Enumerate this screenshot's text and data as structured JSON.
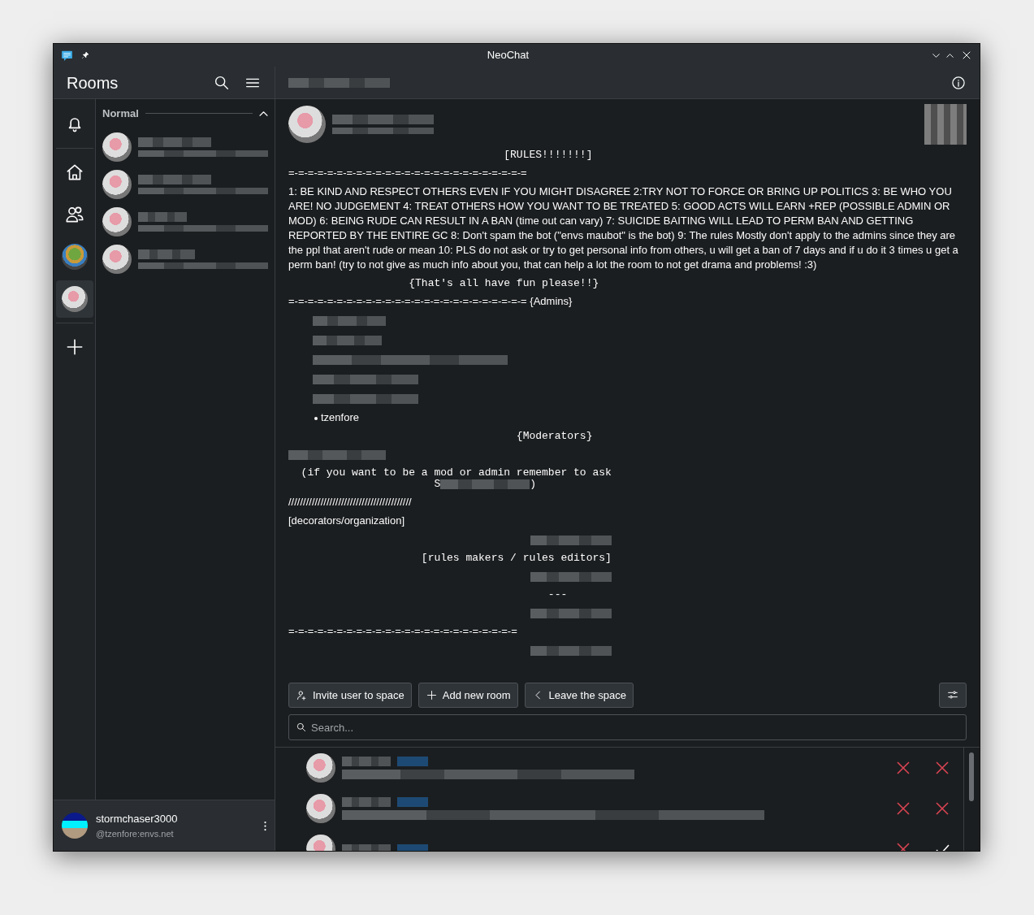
{
  "window": {
    "title": "NeoChat"
  },
  "sidebar": {
    "title": "Rooms",
    "spaces": [
      {
        "kind": "bell",
        "selected": false
      },
      {
        "kind": "home",
        "selected": false
      },
      {
        "kind": "people",
        "selected": false
      },
      {
        "kind": "space-avatar",
        "selected": false
      },
      {
        "kind": "room-avatar",
        "selected": true
      },
      {
        "kind": "add",
        "selected": false
      }
    ],
    "section": {
      "label": "Normal",
      "expanded": true
    },
    "rooms": [
      {
        "kind": "redacted"
      },
      {
        "kind": "redacted"
      },
      {
        "kind": "redacted"
      },
      {
        "kind": "redacted"
      }
    ],
    "user": {
      "name": "stormchaser3000",
      "id": "@tzenfore:envs.net"
    }
  },
  "message": {
    "lines": [
      {
        "kind": "mono",
        "text": "                                  [RULES!!!!!!!]"
      },
      {
        "kind": "text",
        "text": "=-=-=-=-=-=-=-=-=-=-=-=-=-=-=-=-=-=-=-=-=-=-=-=-="
      },
      {
        "kind": "text",
        "text": "1: BE KIND AND RESPECT OTHERS EVEN IF YOU MIGHT DISAGREE 2:TRY NOT TO FORCE OR BRING UP POLITICS 3: BE WHO YOU ARE! NO JUDGEMENT 4: TREAT OTHERS HOW YOU WANT TO BE TREATED 5: GOOD ACTS WILL EARN +REP (POSSIBLE ADMIN OR MOD) 6: BEING RUDE CAN RESULT IN A BAN (time out can vary) 7: SUICIDE BAITING WILL LEAD TO PERM BAN AND GETTING REPORTED BY THE ENTIRE GC 8: Don't spam the bot (\"envs maubot\" is the bot) 9: The rules Mostly don't apply to the admins since they are the ppl that aren't rude or mean 10: PLS do not ask or try to get personal info from others, u will get a ban of 7 days and if u do it 3 times u get a perm ban! (try to not give as much info about you, that can help a lot the room to not get drama and problems! :3)"
      },
      {
        "kind": "mono",
        "text": "                   {That's all have fun please!!}"
      },
      {
        "kind": "text",
        "text": "=-=-=-=-=-=-=-=-=-=-=-=-=-=-=-=-=-=-=-=-=-=-=-=-= {Admins}"
      },
      {
        "kind": "bullet-redacted"
      },
      {
        "kind": "bullet-redacted"
      },
      {
        "kind": "bullet-redacted"
      },
      {
        "kind": "bullet-redacted"
      },
      {
        "kind": "bullet-redacted"
      },
      {
        "kind": "bullet",
        "text": "tzenfore"
      },
      {
        "kind": "mono",
        "text": "                                    {Moderators}"
      },
      {
        "kind": "redacted-left"
      },
      {
        "kind": "mono",
        "text": "  (if you want to be a mod or admin remember to ask"
      },
      {
        "kind": "mono-redacted",
        "text": "                       S",
        "after": ")"
      },
      {
        "kind": "text",
        "text": "//////////////////////////////////////////"
      },
      {
        "kind": "text",
        "text": "[decorators/organization]"
      },
      {
        "kind": "redacted-center"
      },
      {
        "kind": "mono",
        "text": "                     [rules makers / rules editors]"
      },
      {
        "kind": "redacted-center"
      },
      {
        "kind": "mono",
        "text": "                                         ---"
      },
      {
        "kind": "redacted-center"
      },
      {
        "kind": "text",
        "text": "=-=-=-=-=-=-=-=-=-=-=-=-=-=-=-=-=-=-=-=-=-=-=-="
      },
      {
        "kind": "redacted-center"
      }
    ]
  },
  "actions": [
    {
      "kind": "invite",
      "label": "Invite user to space"
    },
    {
      "kind": "add",
      "label": "Add new room"
    },
    {
      "kind": "leave",
      "label": "Leave the space"
    }
  ],
  "search": {
    "placeholder": "Search..."
  },
  "requests": [
    {
      "actions": [
        {
          "kind": "reject"
        },
        {
          "kind": "reject"
        }
      ]
    },
    {
      "actions": [
        {
          "kind": "reject"
        },
        {
          "kind": "reject"
        }
      ]
    },
    {
      "actions": [
        {
          "kind": "reject"
        },
        {
          "kind": "accept"
        }
      ]
    }
  ]
}
